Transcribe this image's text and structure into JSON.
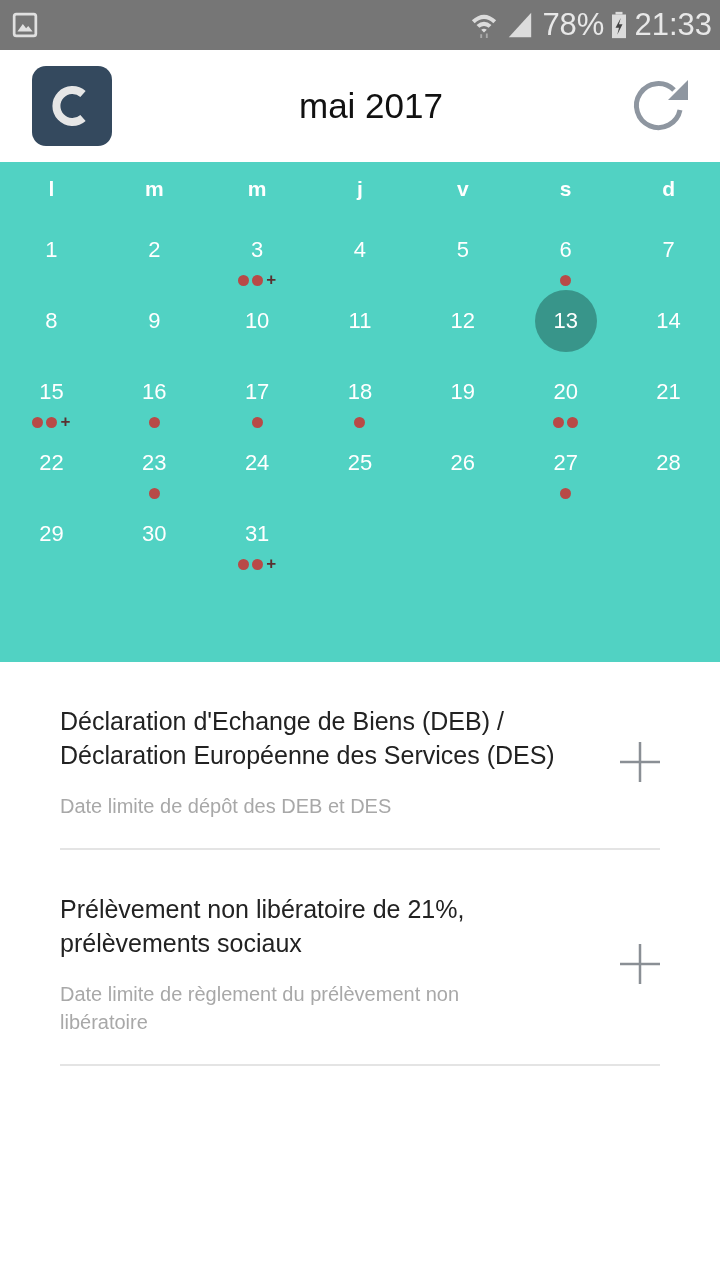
{
  "status_bar": {
    "battery": "78%",
    "time": "21:33"
  },
  "header": {
    "title": "mai 2017"
  },
  "calendar": {
    "weekdays": [
      "l",
      "m",
      "m",
      "j",
      "v",
      "s",
      "d"
    ],
    "days": [
      {
        "label": "1",
        "selected": false
      },
      {
        "label": "2",
        "selected": false
      },
      {
        "label": "3",
        "selected": false,
        "events": [
          {
            "color": "#b84a47"
          },
          {
            "color": "#b84a47"
          }
        ],
        "more": "+"
      },
      {
        "label": "4",
        "selected": false
      },
      {
        "label": "5",
        "selected": false
      },
      {
        "label": "6",
        "selected": false,
        "events": [
          {
            "color": "#b84a47"
          }
        ]
      },
      {
        "label": "7",
        "selected": false
      },
      {
        "label": "8",
        "selected": false
      },
      {
        "label": "9",
        "selected": false
      },
      {
        "label": "10",
        "selected": false
      },
      {
        "label": "11",
        "selected": false
      },
      {
        "label": "12",
        "selected": false
      },
      {
        "label": "13",
        "selected": true
      },
      {
        "label": "14",
        "selected": false
      },
      {
        "label": "15",
        "selected": false,
        "events": [
          {
            "color": "#b84a47"
          },
          {
            "color": "#b84a47"
          }
        ],
        "more": "+"
      },
      {
        "label": "16",
        "selected": false,
        "events": [
          {
            "color": "#b84a47"
          }
        ]
      },
      {
        "label": "17",
        "selected": false,
        "events": [
          {
            "color": "#b84a47"
          }
        ]
      },
      {
        "label": "18",
        "selected": false,
        "events": [
          {
            "color": "#b84a47"
          }
        ]
      },
      {
        "label": "19",
        "selected": false
      },
      {
        "label": "20",
        "selected": false,
        "events": [
          {
            "color": "#b84a47"
          },
          {
            "color": "#b84a47"
          }
        ]
      },
      {
        "label": "21",
        "selected": false
      },
      {
        "label": "22",
        "selected": false
      },
      {
        "label": "23",
        "selected": false,
        "events": [
          {
            "color": "#b84a47"
          }
        ]
      },
      {
        "label": "24",
        "selected": false
      },
      {
        "label": "25",
        "selected": false
      },
      {
        "label": "26",
        "selected": false
      },
      {
        "label": "27",
        "selected": false,
        "events": [
          {
            "color": "#b84a47"
          }
        ]
      },
      {
        "label": "28",
        "selected": false
      },
      {
        "label": "29",
        "selected": false
      },
      {
        "label": "30",
        "selected": false
      },
      {
        "label": "31",
        "selected": false,
        "events": [
          {
            "color": "#b84a47"
          },
          {
            "color": "#b84a47"
          }
        ],
        "more": "+"
      }
    ]
  },
  "events": [
    {
      "title": "Déclaration d'Echange de Biens (DEB) / Déclaration Européenne des Services (DES)",
      "subtitle": "Date limite de dépôt des DEB et DES"
    },
    {
      "title": "Prélèvement non libératoire de 21%, prélèvements sociaux",
      "subtitle": "Date limite de règlement du prélèvement non libératoire"
    }
  ]
}
